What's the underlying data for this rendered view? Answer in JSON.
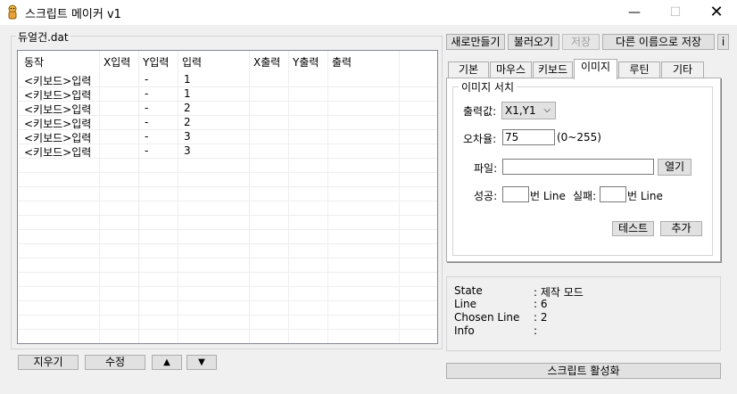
{
  "window": {
    "title": "스크립트 메이커 v1",
    "minimize": "—",
    "maximize": "☐",
    "close": "✕"
  },
  "left": {
    "group_title": "듀얼건.dat",
    "columns": [
      "동작",
      "X입력",
      "Y입력",
      "입력",
      "X출력",
      "Y출력",
      "출력"
    ],
    "rows": [
      [
        "<키보드>입력",
        "",
        "-",
        "1",
        "",
        "",
        ""
      ],
      [
        "<키보드>입력",
        "",
        "-",
        "1",
        "",
        "",
        ""
      ],
      [
        "<키보드>입력",
        "",
        "-",
        "2",
        "",
        "",
        ""
      ],
      [
        "<키보드>입력",
        "",
        "-",
        "2",
        "",
        "",
        ""
      ],
      [
        "<키보드>입력",
        "",
        "-",
        "3",
        "",
        "",
        ""
      ],
      [
        "<키보드>입력",
        "",
        "-",
        "3",
        "",
        "",
        ""
      ]
    ],
    "buttons": {
      "clear": "지우기",
      "edit": "수정",
      "up": "▲",
      "down": "▼"
    }
  },
  "toolbar": {
    "new": "새로만들기",
    "load": "불러오기",
    "save": "저장",
    "save_as": "다른 이름으로 저장",
    "info": "i"
  },
  "tabs": [
    "기본",
    "마우스",
    "키보드",
    "이미지",
    "루틴",
    "기타"
  ],
  "image_search": {
    "group_title": "이미지 서치",
    "output_label": "출력값:",
    "output_value": "X1,Y1",
    "tolerance_label": "오차율:",
    "tolerance_value": "75",
    "tolerance_range": "(0~255)",
    "file_label": "파일:",
    "file_value": "",
    "open_button": "열기",
    "success_label": "성공:",
    "success_value": "",
    "line_unit_1": "번 Line",
    "fail_label": "실패:",
    "fail_value": "",
    "line_unit_2": "번 Line",
    "test_button": "테스트",
    "add_button": "추가"
  },
  "status": [
    {
      "key": "State",
      "value": ": 제작 모드"
    },
    {
      "key": "Line",
      "value": ": 6"
    },
    {
      "key": "Chosen Line",
      "value": ": 2"
    },
    {
      "key": "Info",
      "value": ":"
    }
  ],
  "activate_button": "스크립트 활성화"
}
